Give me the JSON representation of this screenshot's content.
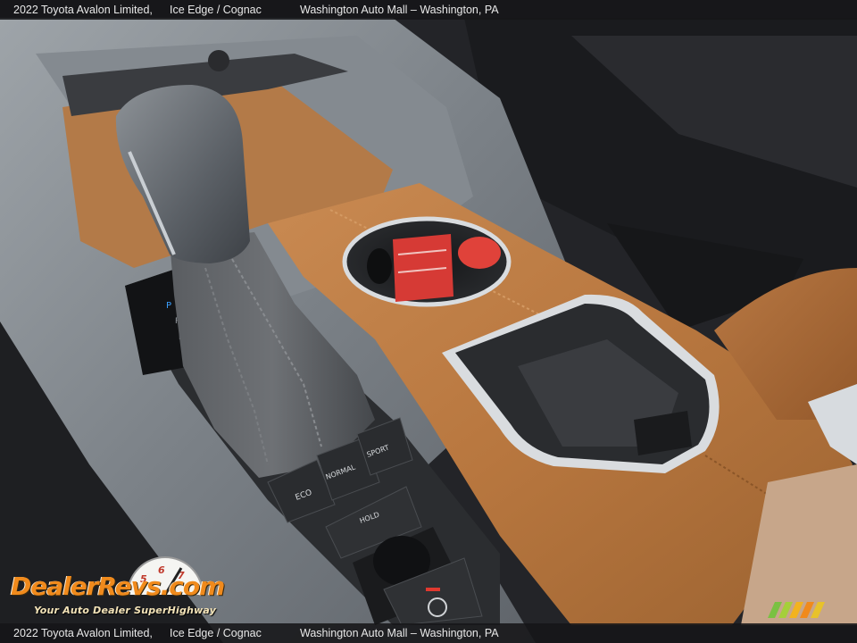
{
  "caption": {
    "vehicle": "2022 Toyota Avalon Limited,",
    "color": "Ice Edge / Cognac",
    "dealer": "Washington Auto Mall – Washington, PA"
  },
  "logo": {
    "name": "DealerRevs.com",
    "tagline": "Your Auto Dealer SuperHighway"
  },
  "console_buttons": {
    "eco": "ECO",
    "normal": "NORMAL",
    "sport": "SPORT",
    "hold": "HOLD"
  },
  "colors": {
    "cognac_leather": "#b8773f",
    "trim_gray": "#8a9096",
    "caption_bg": "#161618",
    "logo_orange": "#f08a1c",
    "key_tag_red": "#d63a35"
  }
}
